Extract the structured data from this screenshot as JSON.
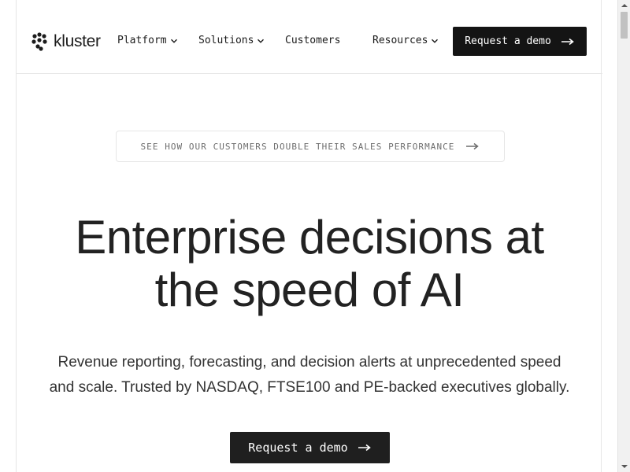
{
  "brand": {
    "name": "kluster",
    "logo_icon": "dot-cluster-logo-icon"
  },
  "nav": {
    "items": [
      {
        "label": "Platform",
        "has_dropdown": true
      },
      {
        "label": "Solutions",
        "has_dropdown": true
      },
      {
        "label": "Customers",
        "has_dropdown": false
      },
      {
        "label": "Resources",
        "has_dropdown": true
      }
    ],
    "cta_label": "Request a demo",
    "cta_icon": "arrow-right-icon"
  },
  "announcement": {
    "text": "SEE HOW OUR CUSTOMERS DOUBLE THEIR SALES PERFORMANCE",
    "icon": "arrow-right-icon"
  },
  "hero": {
    "title_line1": "Enterprise decisions at",
    "title_line2": "the speed of AI",
    "subtitle_line1": "Revenue reporting, forecasting, and decision alerts at unprecedented speed",
    "subtitle_line2": "and scale. Trusted by NASDAQ, FTSE100 and PE-backed executives globally.",
    "cta_label": "Request a demo",
    "cta_icon": "arrow-right-icon"
  },
  "colors": {
    "primary_button": "#141414",
    "text": "#222222",
    "muted_text": "#6d6d6d",
    "border": "#e6e6e6"
  }
}
